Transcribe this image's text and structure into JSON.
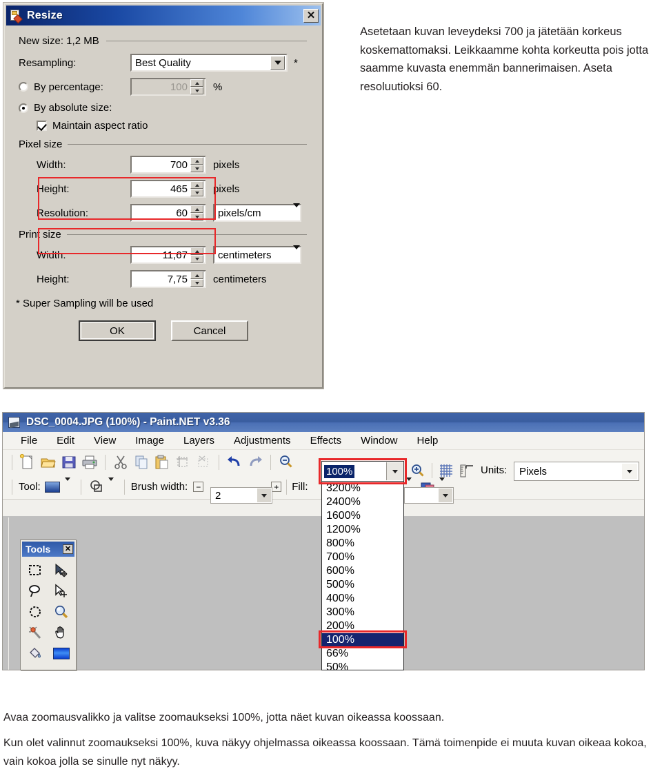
{
  "resize_dialog": {
    "title": "Resize",
    "close_label": "✕",
    "new_size_label": "New size: 1,2 MB",
    "resampling_label": "Resampling:",
    "resampling_value": "Best Quality",
    "asterisk": "*",
    "by_percentage_label": "By percentage:",
    "by_percentage_value": "100",
    "percent_symbol": "%",
    "by_absolute_label": "By absolute size:",
    "maintain_aspect_label": "Maintain aspect ratio",
    "pixel_size_group": "Pixel size",
    "pixel_width_label": "Width:",
    "pixel_width_value": "700",
    "pixel_width_unit": "pixels",
    "pixel_height_label": "Height:",
    "pixel_height_value": "465",
    "pixel_height_unit": "pixels",
    "resolution_label": "Resolution:",
    "resolution_value": "60",
    "resolution_unit": "pixels/cm",
    "print_size_group": "Print size",
    "print_width_label": "Width:",
    "print_width_value": "11,67",
    "print_width_unit": "centimeters",
    "print_height_label": "Height:",
    "print_height_value": "7,75",
    "print_height_unit": "centimeters",
    "footnote": "* Super Sampling will be used",
    "ok_label": "OK",
    "cancel_label": "Cancel",
    "highlight_color": "#e8282a"
  },
  "instructions": {
    "top": "Asetetaan kuvan leveydeksi 700 ja jätetään korkeus koskemattomaksi. Leikkaamme kohta korkeutta pois jotta saamme kuvasta enemmän bannerimaisen. Aseta resoluutioksi 60.",
    "bottom_1": "Avaa zoomausvalikko ja valitse zoomaukseksi 100%, jotta näet kuvan oikeassa koossaan.",
    "bottom_2": "Kun olet valinnut zoomaukseksi 100%, kuva näkyy ohjelmassa oikeassa koossaan. Tämä toimenpide ei muuta kuvan oikeaa kokoa, vain kokoa jolla se sinulle nyt näkyy."
  },
  "paintnet": {
    "title": "DSC_0004.JPG (100%) - Paint.NET v3.36",
    "menus": [
      "File",
      "Edit",
      "View",
      "Image",
      "Layers",
      "Adjustments",
      "Effects",
      "Window",
      "Help"
    ],
    "toolbar_icons": [
      "new-file-icon",
      "open-folder-icon",
      "save-icon",
      "print-icon",
      "cut-icon",
      "copy-icon",
      "paste-icon",
      "crop-icon",
      "deselect-icon",
      "undo-icon",
      "redo-icon",
      "zoom-out-icon"
    ],
    "zoom_combo_value": "100%",
    "zoom_in_icon": "zoom-in-icon",
    "grid_icon": "grid-icon",
    "ruler_icon": "ruler-icon",
    "units_label": "Units:",
    "units_value": "Pixels",
    "zoom_options": [
      "3200%",
      "2400%",
      "1600%",
      "1200%",
      "800%",
      "700%",
      "600%",
      "500%",
      "400%",
      "300%",
      "200%",
      "100%",
      "66%",
      "50%"
    ],
    "zoom_selected": "100%",
    "tool_label": "Tool:",
    "shape_icon": "shapes-icon",
    "brush_width_label": "Brush width:",
    "brush_width_value": "2",
    "brush_minus": "−",
    "brush_plus": "+",
    "fill_label": "Fill:",
    "curve_icon": "curve-icon",
    "blend_icon": "blend-mode-icon",
    "tools_palette": {
      "title": "Tools",
      "close_label": "✕",
      "tools": [
        "rectangle-select-icon",
        "move-selected-icon",
        "lasso-select-icon",
        "move-selection-icon",
        "ellipse-select-icon",
        "zoom-tool-icon",
        "magic-wand-icon",
        "pan-icon",
        "paint-bucket-icon",
        "gradient-icon"
      ]
    }
  }
}
